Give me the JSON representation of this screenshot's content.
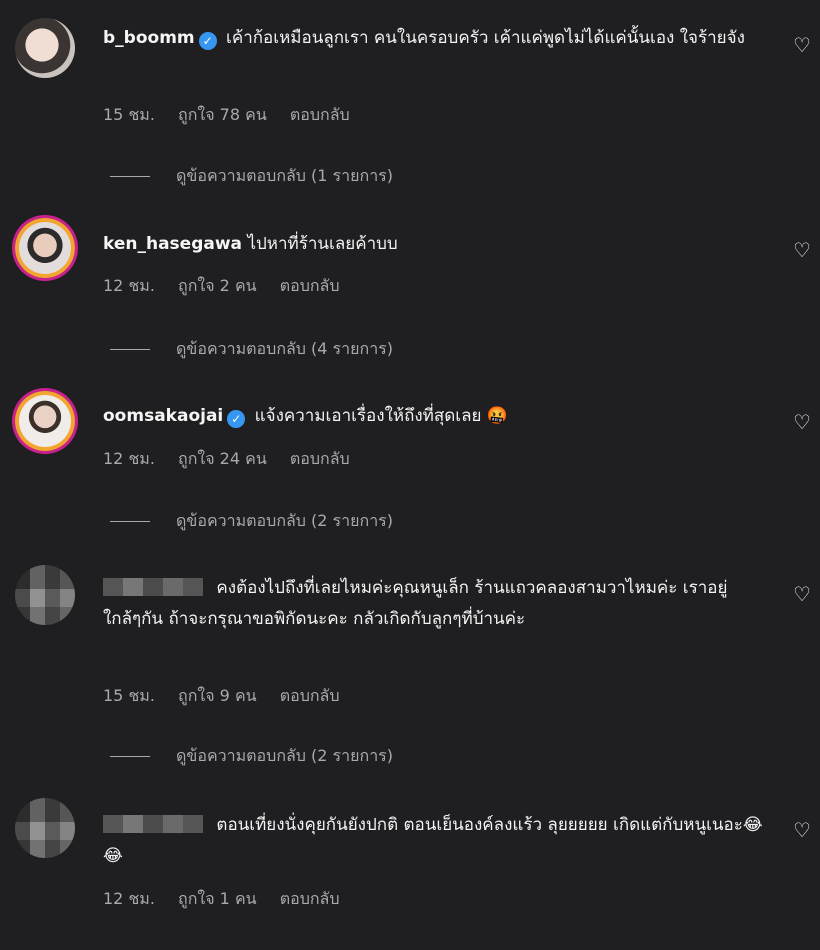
{
  "comments": [
    {
      "username": "b_boomm",
      "verified": true,
      "text": "เค้าก้อเหมือนลูกเรา คนในครอบครัว เค้าแค่พูดไม่ได้แค่นั้นเอง ใจร้ายจัง",
      "time": "15 ชม.",
      "likes": "ถูกใจ 78 คน",
      "reply": "ตอบกลับ",
      "view_replies": "ดูข้อความตอบกลับ (1 รายการ)"
    },
    {
      "username": "ken_hasegawa",
      "verified": false,
      "text": "ไปหาที่ร้านเลยค้าบบ",
      "time": "12 ชม.",
      "likes": "ถูกใจ 2 คน",
      "reply": "ตอบกลับ",
      "view_replies": "ดูข้อความตอบกลับ (4 รายการ)"
    },
    {
      "username": "oomsakaojai",
      "verified": true,
      "text": "แจ้งความเอาเรื่องให้ถึงที่สุดเลย 🤬",
      "time": "12 ชม.",
      "likes": "ถูกใจ 24 คน",
      "reply": "ตอบกลับ",
      "view_replies": "ดูข้อความตอบกลับ (2 รายการ)"
    },
    {
      "username": "",
      "verified": false,
      "text": "คงต้องไปถึงที่เลยไหมค่ะคุณหนูเล็ก ร้านแถวคลองสามวาไหมค่ะ เราอยู่ใกล้ๆกัน ถ้าจะกรุณาขอพิกัดนะคะ กลัวเกิดกับลูกๆที่บ้านค่ะ",
      "time": "15 ชม.",
      "likes": "ถูกใจ 9 คน",
      "reply": "ตอบกลับ",
      "view_replies": "ดูข้อความตอบกลับ (2 รายการ)"
    },
    {
      "username": "",
      "verified": false,
      "text": "ตอนเที่ยงนั่งคุยกันยังปกติ ตอนเย็นองค์ลงแร้ว ลุยยยยย เกิดแต่กับหนูเนอะ😂 😂",
      "time": "12 ชม.",
      "likes": "ถูกใจ 1 คน",
      "reply": "ตอบกลับ"
    }
  ],
  "icons": {
    "heart": "heart-outline-icon",
    "verified": "verified-badge-icon"
  },
  "colors": {
    "background": "#1f1f22",
    "verified": "#3797f0",
    "muted": "#a9a9ad"
  }
}
